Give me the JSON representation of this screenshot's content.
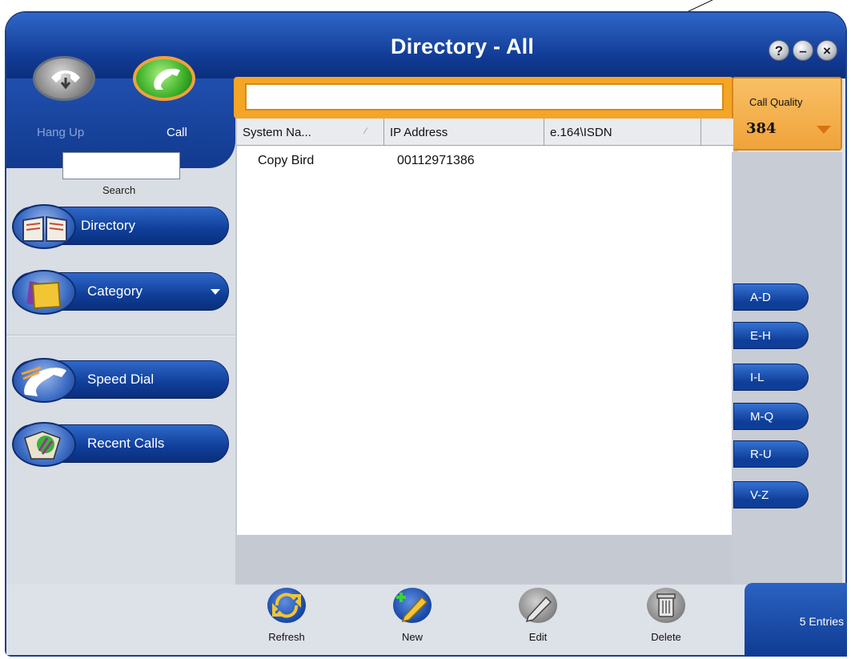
{
  "window": {
    "title": "Directory - All",
    "controls": [
      "help-icon",
      "minimize-icon",
      "close-icon"
    ]
  },
  "call_controls": {
    "hang_up_label": "Hang Up",
    "call_label": "Call"
  },
  "search": {
    "value": "",
    "label": "Search"
  },
  "nav": {
    "items": [
      {
        "label": "Directory",
        "icon": "book-icon"
      },
      {
        "label": "Category",
        "icon": "folder-icon"
      },
      {
        "label": "Speed Dial",
        "icon": "phone-icon"
      },
      {
        "label": "Recent Calls",
        "icon": "recent-calls-icon"
      }
    ]
  },
  "address_bar": {
    "value": ""
  },
  "call_quality": {
    "label": "Call Quality",
    "value": "384"
  },
  "table": {
    "columns": [
      "System Na...",
      "IP Address",
      "e.164\\ISDN"
    ],
    "rows": [
      {
        "system_name": "Copy Bird",
        "ip_address": "00112971386",
        "isdn": ""
      }
    ]
  },
  "alpha_filters": [
    "A-D",
    "E-H",
    "I-L",
    "M-Q",
    "R-U",
    "V-Z"
  ],
  "toolbar": {
    "refresh_label": "Refresh",
    "new_label": "New",
    "edit_label": "Edit",
    "delete_label": "Delete"
  },
  "status": {
    "entries": "5 Entries"
  },
  "colors": {
    "brand_blue": "#123a8e",
    "accent_orange": "#f5a526",
    "call_green": "#3db02a"
  }
}
